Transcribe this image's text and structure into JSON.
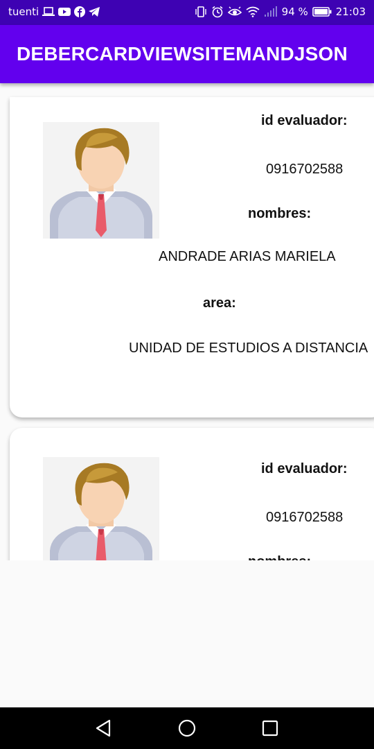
{
  "status_bar": {
    "carrier": "tuenti",
    "battery_percent": "94 %",
    "time": "21:03",
    "icons_left": [
      "laptop-icon",
      "youtube-icon",
      "facebook-icon",
      "telegram-icon"
    ],
    "icons_right": [
      "vibrate-icon",
      "alarm-icon",
      "eye-icon",
      "wifi-icon",
      "signal-icon",
      "battery-icon"
    ]
  },
  "app_bar": {
    "title": "DEBERCARDVIEWSITEMANDJSON"
  },
  "cards": [
    {
      "id_label": "id evaluador:",
      "id_value": "0916702588",
      "name_label": "nombres:",
      "name_value": "ANDRADE ARIAS MARIELA",
      "area_label": "area:",
      "area_value": "UNIDAD DE ESTUDIOS A DISTANCIA"
    },
    {
      "id_label": "id evaluador:",
      "id_value": "0916702588",
      "name_label": "nombres:"
    }
  ],
  "nav_bar": {
    "buttons": [
      "back-icon",
      "home-icon",
      "recents-icon"
    ]
  },
  "colors": {
    "status_bar": "#3e02b3",
    "app_bar": "#6200ee",
    "background": "#fafafa",
    "card": "#ffffff"
  }
}
